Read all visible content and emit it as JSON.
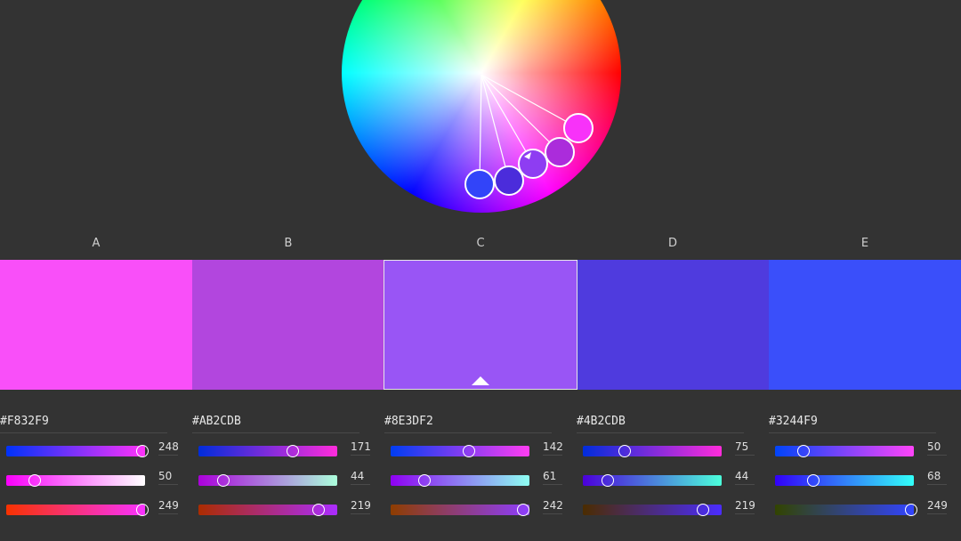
{
  "colors": {
    "background": "#333333"
  },
  "wheel": {
    "handles": [
      {
        "name": "A",
        "hex": "#F832F9"
      },
      {
        "name": "B",
        "hex": "#AB2CDB"
      },
      {
        "name": "C",
        "hex": "#8E3DF2"
      },
      {
        "name": "D",
        "hex": "#4B2CDB"
      },
      {
        "name": "E",
        "hex": "#3244F9"
      }
    ]
  },
  "swatches": [
    {
      "label": "A",
      "hex": "#F832F9",
      "display_color": "#f94ff9",
      "selected": false,
      "rgb": [
        248,
        50,
        249
      ],
      "track_gradients": [
        "linear-gradient(90deg,#0032f9,#ff32f9)",
        "linear-gradient(90deg,#f800f9,#ffffff)",
        "linear-gradient(90deg,#f83200,#f832ff)"
      ]
    },
    {
      "label": "B",
      "hex": "#AB2CDB",
      "display_color": "#b246de",
      "selected": false,
      "rgb": [
        171,
        44,
        219
      ],
      "track_gradients": [
        "linear-gradient(90deg,#002cdb,#ff2cdb)",
        "linear-gradient(90deg,#ab00db,#abffdb)",
        "linear-gradient(90deg,#ab2c00,#ab2cff)"
      ]
    },
    {
      "label": "C",
      "hex": "#8E3DF2",
      "display_color": "#9955f5",
      "selected": true,
      "rgb": [
        142,
        61,
        242
      ],
      "track_gradients": [
        "linear-gradient(90deg,#003df2,#ff3df2)",
        "linear-gradient(90deg,#8e00f2,#8efff2)",
        "linear-gradient(90deg,#8e3d00,#8e3dff)"
      ]
    },
    {
      "label": "D",
      "hex": "#4B2CDB",
      "display_color": "#4f3bde",
      "selected": false,
      "rgb": [
        75,
        44,
        219
      ],
      "track_gradients": [
        "linear-gradient(90deg,#002cdb,#ff2cdb)",
        "linear-gradient(90deg,#4b00db,#4bffdb)",
        "linear-gradient(90deg,#4b2c00,#4b2cff)"
      ]
    },
    {
      "label": "E",
      "hex": "#3244F9",
      "display_color": "#3a4ffa",
      "selected": false,
      "rgb": [
        50,
        68,
        249
      ],
      "track_gradients": [
        "linear-gradient(90deg,#0044f9,#ff44f9)",
        "linear-gradient(90deg,#3200f9,#32fff9)",
        "linear-gradient(90deg,#324400,#3244ff)"
      ]
    }
  ]
}
